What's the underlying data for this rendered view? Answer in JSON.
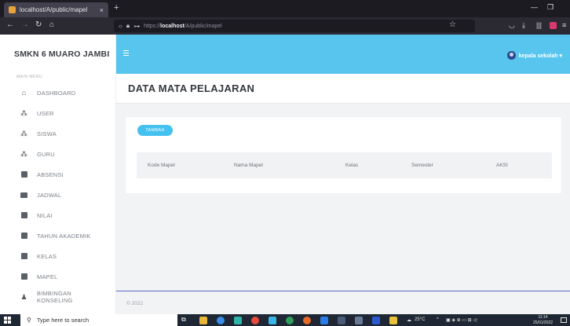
{
  "browser": {
    "tab_title": "localhost/A/public/mapel",
    "tab_close": "×",
    "new_tab": "+",
    "url_scheme": "https://",
    "url_host": "localhost",
    "url_path": "/A/public/mapel"
  },
  "app": {
    "brand": "SMKN 6 MUARO JAMBI",
    "main_menu_label": "MAIN MENU",
    "user_name": "kepala sekolah ▾",
    "page_title": "DATA MATA PELAJARAN",
    "add_button": "TAMBAH",
    "footer": "© 2022"
  },
  "sidebar": {
    "items": [
      {
        "label": "DASHBOARD",
        "icon": "home-icon"
      },
      {
        "label": "USER",
        "icon": "users-icon"
      },
      {
        "label": "SISWA",
        "icon": "users-icon"
      },
      {
        "label": "GURU",
        "icon": "users-icon"
      },
      {
        "label": "ABSENSI",
        "icon": "clipboard-icon"
      },
      {
        "label": "JADWAL",
        "icon": "book-icon"
      },
      {
        "label": "NILAI",
        "icon": "tag-icon"
      },
      {
        "label": "TAHUN AKADEMIK",
        "icon": "calendar-icon"
      },
      {
        "label": "KELAS",
        "icon": "calendar-icon"
      },
      {
        "label": "MAPEL",
        "icon": "calendar-icon"
      },
      {
        "label": "BIMBINGAN KONSELING",
        "icon": "person-icon"
      }
    ]
  },
  "table": {
    "headers": [
      "Kode Mapel",
      "Nama Mapel",
      "Kelas",
      "Semester",
      "AKSI"
    ]
  },
  "taskbar": {
    "search_placeholder": "Type here to search",
    "weather": "25°C",
    "time": "11:14",
    "date": "25/01/2022"
  },
  "colors": {
    "header": "#57c5ee",
    "button": "#45c1f0",
    "footer_border": "#5c6bc0"
  }
}
